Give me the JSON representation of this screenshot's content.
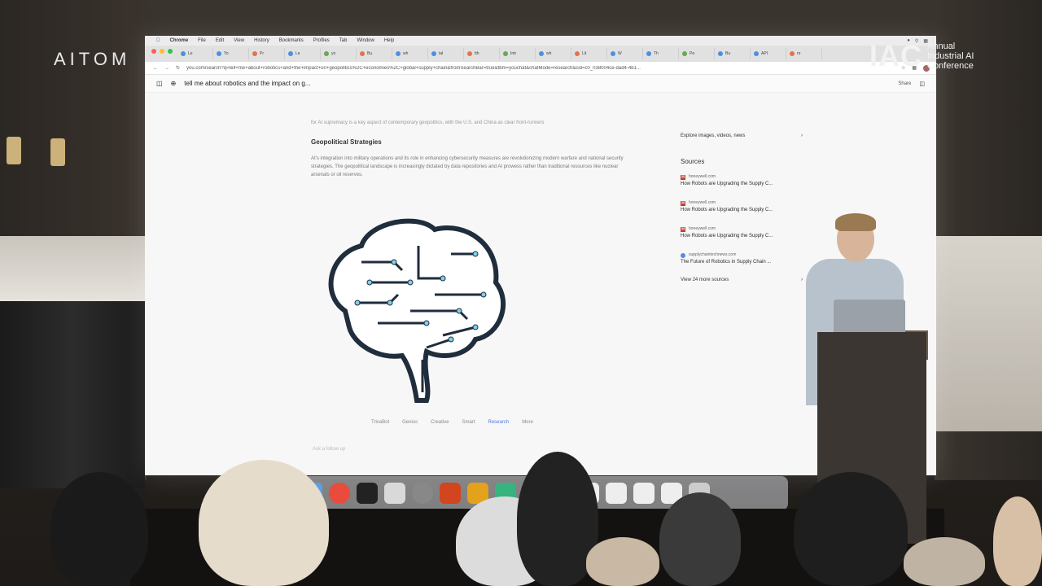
{
  "branding": {
    "left_logo": "AITOM",
    "right_logo_big": "IAC",
    "right_logo_lines": [
      "Annual",
      "Industrial AI",
      "Conference"
    ]
  },
  "browser": {
    "menu": [
      "Chrome",
      "File",
      "Edit",
      "View",
      "History",
      "Bookmarks",
      "Profiles",
      "Tab",
      "Window",
      "Help"
    ],
    "url": "you.com/search?q=tell+me+about+robotics+and+the+impact+on+geopolitics%2C+economies%2C+global+supply+chain&fromSearchBar=true&tbm=youchat&chatMode=research&cid=c0_038004ce-dad4-4b1...",
    "tabs": [
      "Le",
      "Yo",
      "Pr",
      "Le",
      "yo",
      "Bu",
      "wh",
      "tal",
      "tth",
      "Intr",
      "wh",
      "Lit",
      "W",
      "Th",
      "Pe",
      "Bu",
      "API",
      "nr"
    ]
  },
  "chat": {
    "query": "tell me about robotics and the impact on g...",
    "share_label": "Share",
    "lead_text": "for AI supremacy is a key aspect of contemporary geopolitics, with the U.S. and China as clear front-runners",
    "section_title": "Geopolitical Strategies",
    "paragraph": "AI's integration into military operations and its role in enhancing cybersecurity measures are revolutionizing modern warfare and national security strategies. The geopolitical landscape is increasingly dictated by data repositories and AI prowess rather than traditional resources like nuclear arsenals or oil reserves.",
    "modes": [
      "TrivaBot",
      "Genius",
      "Creative",
      "Smart",
      "Research",
      "More"
    ],
    "active_mode": "Research",
    "ask_placeholder": "Ask a follow up"
  },
  "sidebar": {
    "explore_label": "Explore images, videos, news",
    "sources_title": "Sources",
    "sources": [
      {
        "domain": "honeywell.com",
        "title": "How Robots are Upgrading the Supply C...",
        "icon": "H"
      },
      {
        "domain": "honeywell.com",
        "title": "How Robots are Upgrading the Supply C...",
        "icon": "H"
      },
      {
        "domain": "honeywell.com",
        "title": "How Robots are Upgrading the Supply C...",
        "icon": "H"
      },
      {
        "domain": "supplychaintechnews.com",
        "title": "The Future of Robotics in Supply Chain ...",
        "icon": "globe"
      }
    ],
    "view_more_label": "View 24 more sources"
  },
  "colors": {
    "accent": "#4a7be2",
    "brain_stroke": "#1f2d3d",
    "brain_glow": "#7fd1ef"
  }
}
